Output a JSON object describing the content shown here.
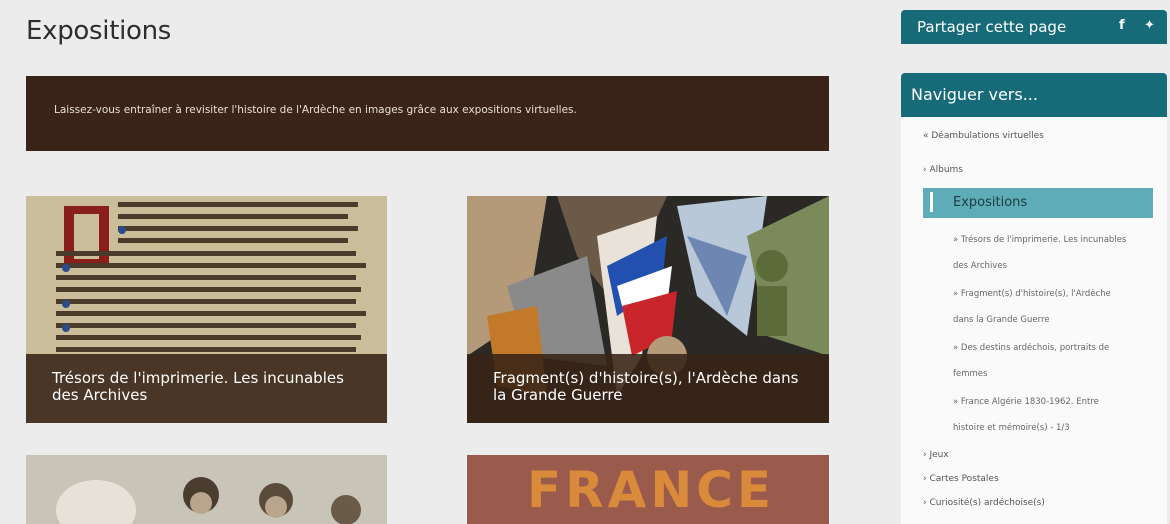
{
  "page": {
    "title": "Expositions",
    "intro": "Laissez-vous entraîner à revisiter l'histoire de l'Ardèche en images grâce aux expositions virtuelles."
  },
  "cards": [
    {
      "title": "Trésors de l'imprimerie. Les incunables des Archives"
    },
    {
      "title": "Fragment(s) d'histoire(s), l'Ardèche dans la Grande Guerre"
    },
    {
      "title": ""
    },
    {
      "title": "",
      "art_text": "FRANCE"
    }
  ],
  "share": {
    "label": "Partager cette page",
    "facebook": "f",
    "twitter": "🐦"
  },
  "nav": {
    "header": "Naviguer vers...",
    "back": "« Déambulations virtuelles",
    "albums": "› Albums",
    "active": "Expositions",
    "sub_items": [
      "» Trésors de l'imprimerie. Les incunables des Archives",
      "» Fragment(s) d'histoire(s), l'Ardèche dans la Grande Guerre",
      "» Des destins ardéchois, portraits de femmes",
      "» France Algérie 1830-1962. Entre histoire et mémoire(s) - 1/3"
    ],
    "jeux": "› Jeux",
    "cartes": "› Cartes Postales",
    "curiosites": "› Curiosité(s) ardéchoise(s)"
  },
  "colors": {
    "teal": "#176b79",
    "active": "#5eacb8",
    "banner": "#3a2318"
  }
}
